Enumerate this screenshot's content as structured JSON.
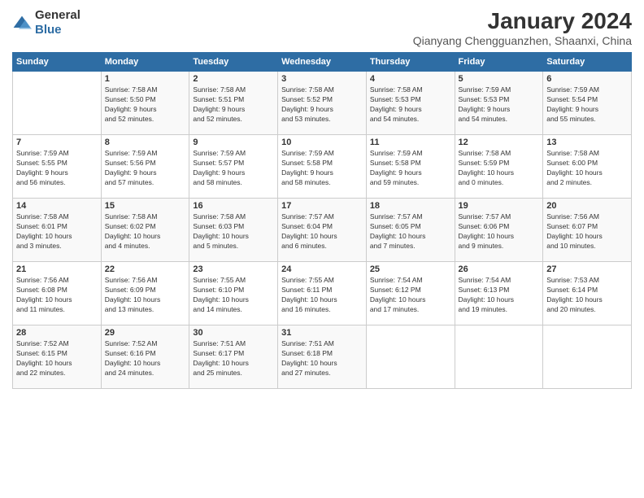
{
  "header": {
    "logo_general": "General",
    "logo_blue": "Blue",
    "title": "January 2024",
    "subtitle": "Qianyang Chengguanzhen, Shaanxi, China"
  },
  "weekdays": [
    "Sunday",
    "Monday",
    "Tuesday",
    "Wednesday",
    "Thursday",
    "Friday",
    "Saturday"
  ],
  "weeks": [
    [
      {
        "day": "",
        "sunrise": "",
        "sunset": "",
        "daylight": ""
      },
      {
        "day": "1",
        "sunrise": "Sunrise: 7:58 AM",
        "sunset": "Sunset: 5:50 PM",
        "daylight": "Daylight: 9 hours and 52 minutes."
      },
      {
        "day": "2",
        "sunrise": "Sunrise: 7:58 AM",
        "sunset": "Sunset: 5:51 PM",
        "daylight": "Daylight: 9 hours and 52 minutes."
      },
      {
        "day": "3",
        "sunrise": "Sunrise: 7:58 AM",
        "sunset": "Sunset: 5:52 PM",
        "daylight": "Daylight: 9 hours and 53 minutes."
      },
      {
        "day": "4",
        "sunrise": "Sunrise: 7:58 AM",
        "sunset": "Sunset: 5:53 PM",
        "daylight": "Daylight: 9 hours and 54 minutes."
      },
      {
        "day": "5",
        "sunrise": "Sunrise: 7:59 AM",
        "sunset": "Sunset: 5:53 PM",
        "daylight": "Daylight: 9 hours and 54 minutes."
      },
      {
        "day": "6",
        "sunrise": "Sunrise: 7:59 AM",
        "sunset": "Sunset: 5:54 PM",
        "daylight": "Daylight: 9 hours and 55 minutes."
      }
    ],
    [
      {
        "day": "7",
        "sunrise": "Sunrise: 7:59 AM",
        "sunset": "Sunset: 5:55 PM",
        "daylight": "Daylight: 9 hours and 56 minutes."
      },
      {
        "day": "8",
        "sunrise": "Sunrise: 7:59 AM",
        "sunset": "Sunset: 5:56 PM",
        "daylight": "Daylight: 9 hours and 57 minutes."
      },
      {
        "day": "9",
        "sunrise": "Sunrise: 7:59 AM",
        "sunset": "Sunset: 5:57 PM",
        "daylight": "Daylight: 9 hours and 58 minutes."
      },
      {
        "day": "10",
        "sunrise": "Sunrise: 7:59 AM",
        "sunset": "Sunset: 5:58 PM",
        "daylight": "Daylight: 9 hours and 58 minutes."
      },
      {
        "day": "11",
        "sunrise": "Sunrise: 7:59 AM",
        "sunset": "Sunset: 5:58 PM",
        "daylight": "Daylight: 9 hours and 59 minutes."
      },
      {
        "day": "12",
        "sunrise": "Sunrise: 7:58 AM",
        "sunset": "Sunset: 5:59 PM",
        "daylight": "Daylight: 10 hours and 0 minutes."
      },
      {
        "day": "13",
        "sunrise": "Sunrise: 7:58 AM",
        "sunset": "Sunset: 6:00 PM",
        "daylight": "Daylight: 10 hours and 2 minutes."
      }
    ],
    [
      {
        "day": "14",
        "sunrise": "Sunrise: 7:58 AM",
        "sunset": "Sunset: 6:01 PM",
        "daylight": "Daylight: 10 hours and 3 minutes."
      },
      {
        "day": "15",
        "sunrise": "Sunrise: 7:58 AM",
        "sunset": "Sunset: 6:02 PM",
        "daylight": "Daylight: 10 hours and 4 minutes."
      },
      {
        "day": "16",
        "sunrise": "Sunrise: 7:58 AM",
        "sunset": "Sunset: 6:03 PM",
        "daylight": "Daylight: 10 hours and 5 minutes."
      },
      {
        "day": "17",
        "sunrise": "Sunrise: 7:57 AM",
        "sunset": "Sunset: 6:04 PM",
        "daylight": "Daylight: 10 hours and 6 minutes."
      },
      {
        "day": "18",
        "sunrise": "Sunrise: 7:57 AM",
        "sunset": "Sunset: 6:05 PM",
        "daylight": "Daylight: 10 hours and 7 minutes."
      },
      {
        "day": "19",
        "sunrise": "Sunrise: 7:57 AM",
        "sunset": "Sunset: 6:06 PM",
        "daylight": "Daylight: 10 hours and 9 minutes."
      },
      {
        "day": "20",
        "sunrise": "Sunrise: 7:56 AM",
        "sunset": "Sunset: 6:07 PM",
        "daylight": "Daylight: 10 hours and 10 minutes."
      }
    ],
    [
      {
        "day": "21",
        "sunrise": "Sunrise: 7:56 AM",
        "sunset": "Sunset: 6:08 PM",
        "daylight": "Daylight: 10 hours and 11 minutes."
      },
      {
        "day": "22",
        "sunrise": "Sunrise: 7:56 AM",
        "sunset": "Sunset: 6:09 PM",
        "daylight": "Daylight: 10 hours and 13 minutes."
      },
      {
        "day": "23",
        "sunrise": "Sunrise: 7:55 AM",
        "sunset": "Sunset: 6:10 PM",
        "daylight": "Daylight: 10 hours and 14 minutes."
      },
      {
        "day": "24",
        "sunrise": "Sunrise: 7:55 AM",
        "sunset": "Sunset: 6:11 PM",
        "daylight": "Daylight: 10 hours and 16 minutes."
      },
      {
        "day": "25",
        "sunrise": "Sunrise: 7:54 AM",
        "sunset": "Sunset: 6:12 PM",
        "daylight": "Daylight: 10 hours and 17 minutes."
      },
      {
        "day": "26",
        "sunrise": "Sunrise: 7:54 AM",
        "sunset": "Sunset: 6:13 PM",
        "daylight": "Daylight: 10 hours and 19 minutes."
      },
      {
        "day": "27",
        "sunrise": "Sunrise: 7:53 AM",
        "sunset": "Sunset: 6:14 PM",
        "daylight": "Daylight: 10 hours and 20 minutes."
      }
    ],
    [
      {
        "day": "28",
        "sunrise": "Sunrise: 7:52 AM",
        "sunset": "Sunset: 6:15 PM",
        "daylight": "Daylight: 10 hours and 22 minutes."
      },
      {
        "day": "29",
        "sunrise": "Sunrise: 7:52 AM",
        "sunset": "Sunset: 6:16 PM",
        "daylight": "Daylight: 10 hours and 24 minutes."
      },
      {
        "day": "30",
        "sunrise": "Sunrise: 7:51 AM",
        "sunset": "Sunset: 6:17 PM",
        "daylight": "Daylight: 10 hours and 25 minutes."
      },
      {
        "day": "31",
        "sunrise": "Sunrise: 7:51 AM",
        "sunset": "Sunset: 6:18 PM",
        "daylight": "Daylight: 10 hours and 27 minutes."
      },
      {
        "day": "",
        "sunrise": "",
        "sunset": "",
        "daylight": ""
      },
      {
        "day": "",
        "sunrise": "",
        "sunset": "",
        "daylight": ""
      },
      {
        "day": "",
        "sunrise": "",
        "sunset": "",
        "daylight": ""
      }
    ]
  ]
}
